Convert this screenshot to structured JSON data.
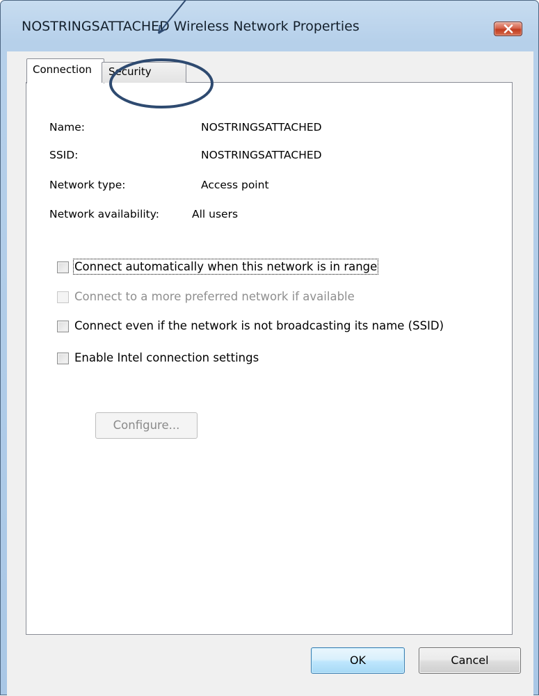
{
  "window": {
    "title": "NOSTRINGSATTACHED Wireless Network Properties",
    "close_icon": "close-x-icon"
  },
  "tabs": [
    {
      "label": "Connection",
      "selected": true
    },
    {
      "label": "Security",
      "selected": false
    }
  ],
  "info": {
    "name_label": "Name:",
    "name_value": "NOSTRINGSATTACHED",
    "ssid_label": "SSID:",
    "ssid_value": "NOSTRINGSATTACHED",
    "type_label": "Network type:",
    "type_value": "Access point",
    "availability_label": "Network availability:",
    "availability_value": "All users"
  },
  "options": [
    {
      "label": "Connect automatically when this network is in range",
      "checked": false,
      "enabled": true
    },
    {
      "label": "Connect to a more preferred network if available",
      "checked": false,
      "enabled": false
    },
    {
      "label": "Connect even if the network is not broadcasting its name (SSID)",
      "checked": false,
      "enabled": true
    },
    {
      "label": "Enable Intel connection settings",
      "checked": false,
      "enabled": true
    }
  ],
  "configure_button": "Configure...",
  "footer": {
    "ok": "OK",
    "cancel": "Cancel"
  },
  "colors": {
    "annotation": "#2e4a70",
    "title_bar": "#b9d1ea",
    "close_button": "#c94a2e",
    "ok_button_border": "#3c7fb1"
  }
}
